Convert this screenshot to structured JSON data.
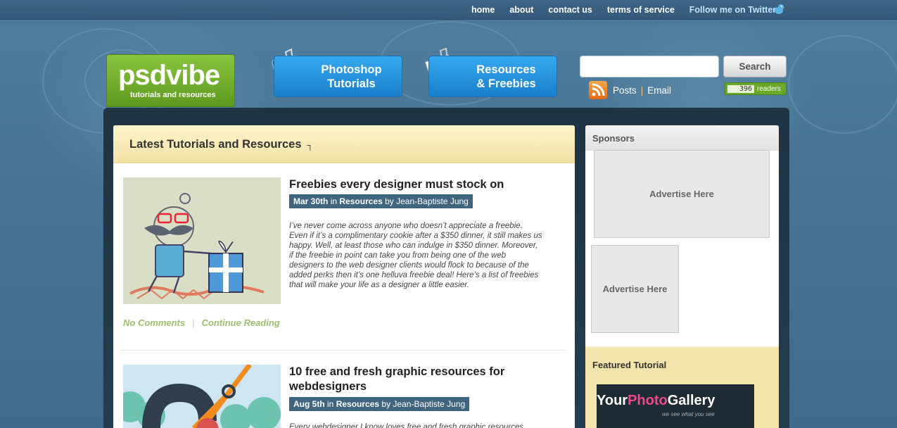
{
  "topnav": {
    "items": [
      "home",
      "about",
      "contact us",
      "terms of service"
    ],
    "twitter": "Follow me on Twitter"
  },
  "logo": {
    "brand": "psdvibe",
    "tagline": "tutorials and resources"
  },
  "nav": {
    "photoshop": {
      "line1": "Photoshop",
      "line2": "Tutorials"
    },
    "resources": {
      "line1": "Resources",
      "line2": "& Freebies"
    }
  },
  "search": {
    "value": "",
    "button": "Search"
  },
  "subscribe": {
    "posts": "Posts",
    "separator": "|",
    "email": "Email",
    "readers_count": "396",
    "readers_label": "readers"
  },
  "main": {
    "heading": "Latest Tutorials and Resources",
    "posts": [
      {
        "title": "Freebies every designer must stock on",
        "date": "Mar 30th",
        "in": "in",
        "category": "Resources",
        "by": "by Jean-Baptiste Jung",
        "excerpt": "I’ve never come across anyone who doesn’t appreciate a freebie. Even if it’s a complimentary cookie after a $350 dinner, it still makes us happy. Well, at least those who can indulge in $350 dinner. Moreover, if the freebie in point can take you from being one of the web designers to the web designer clients would flock to because of the added perks then it’s one helluva freebie deal! Here’s a list of freebies that will make your life as a designer a little easier.",
        "comments": "No Comments",
        "continue": "Continue Reading"
      },
      {
        "title": "10 free and fresh graphic resources for webdesigners",
        "date": "Aug 5th",
        "in": "in",
        "category": "Resources",
        "by": "by Jean-Baptiste Jung",
        "excerpt": "Every webdesigner I know loves free and fresh graphic resources."
      }
    ]
  },
  "sidebar": {
    "sponsors": "Sponsors",
    "ad_big": "Advertise Here",
    "ad_small": "Advertise Here",
    "featured": "Featured Tutorial",
    "featured_title_a": "Your",
    "featured_title_b": "Photo",
    "featured_title_c": "Gallery",
    "featured_sub": "we see what you see"
  }
}
